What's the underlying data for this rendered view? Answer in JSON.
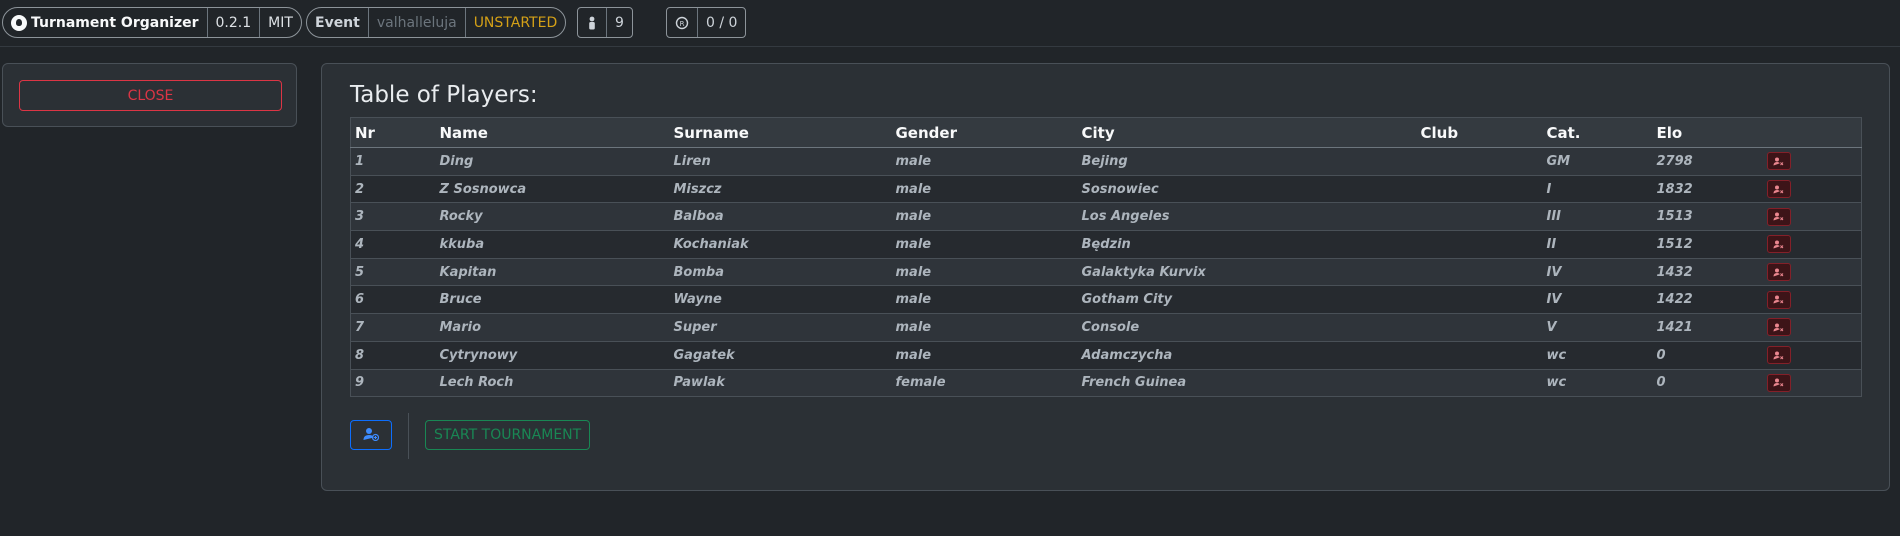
{
  "app": {
    "title": "Turnament Organizer",
    "version": "0.2.1",
    "license": "MIT"
  },
  "event": {
    "label": "Event",
    "name": "valhalleluja",
    "status": "UNSTARTED"
  },
  "players_count": "9",
  "rounds": "0 / 0",
  "left": {
    "close_label": "CLOSE"
  },
  "main": {
    "title": "Table of Players:",
    "columns": [
      "Nr",
      "Name",
      "Surname",
      "Gender",
      "City",
      "Club",
      "Cat.",
      "Elo",
      ""
    ],
    "rows": [
      {
        "nr": "1",
        "name": "Ding",
        "surname": "Liren",
        "gender": "male",
        "city": "Bejing",
        "club": "",
        "cat": "GM",
        "elo": "2798"
      },
      {
        "nr": "2",
        "name": "Z Sosnowca",
        "surname": "Miszcz",
        "gender": "male",
        "city": "Sosnowiec",
        "club": "",
        "cat": "I",
        "elo": "1832"
      },
      {
        "nr": "3",
        "name": "Rocky",
        "surname": "Balboa",
        "gender": "male",
        "city": "Los Angeles",
        "club": "",
        "cat": "III",
        "elo": "1513"
      },
      {
        "nr": "4",
        "name": "kkuba",
        "surname": "Kochaniak",
        "gender": "male",
        "city": "Będzin",
        "club": "",
        "cat": "II",
        "elo": "1512"
      },
      {
        "nr": "5",
        "name": "Kapitan",
        "surname": "Bomba",
        "gender": "male",
        "city": "Galaktyka Kurvix",
        "club": "",
        "cat": "IV",
        "elo": "1432"
      },
      {
        "nr": "6",
        "name": "Bruce",
        "surname": "Wayne",
        "gender": "male",
        "city": "Gotham City",
        "club": "",
        "cat": "IV",
        "elo": "1422"
      },
      {
        "nr": "7",
        "name": "Mario",
        "surname": "Super",
        "gender": "male",
        "city": "Console",
        "club": "",
        "cat": "V",
        "elo": "1421"
      },
      {
        "nr": "8",
        "name": "Cytrynowy",
        "surname": "Gagatek",
        "gender": "male",
        "city": "Adamczycha",
        "club": "",
        "cat": "wc",
        "elo": "0"
      },
      {
        "nr": "9",
        "name": "Lech Roch",
        "surname": "Pawlak",
        "gender": "female",
        "city": "French Guinea",
        "club": "",
        "cat": "wc",
        "elo": "0"
      }
    ],
    "start_label": "START TOURNAMENT"
  },
  "icons": {
    "brand": "github-icon",
    "players": "person-icon",
    "rounds": "rounds-icon",
    "delete": "remove-user-icon",
    "add": "add-user-icon"
  },
  "colors": {
    "danger": "#dc3545",
    "primary": "#0d6efd",
    "success": "#198754",
    "warning": "#d4a017"
  }
}
